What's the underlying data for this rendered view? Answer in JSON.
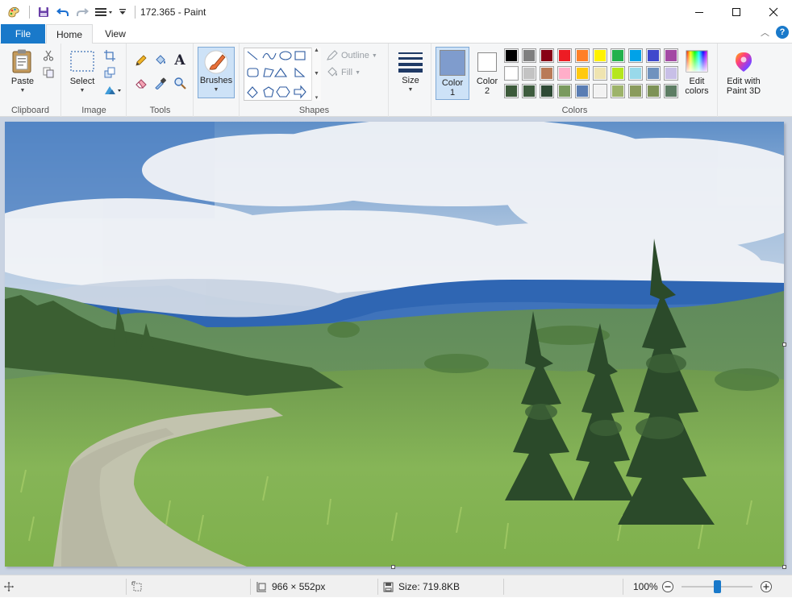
{
  "window": {
    "title": "172.365 - Paint"
  },
  "tabs": {
    "file": "File",
    "home": "Home",
    "view": "View"
  },
  "ribbon": {
    "clipboard": {
      "label": "Clipboard",
      "paste": "Paste"
    },
    "image": {
      "label": "Image",
      "select": "Select"
    },
    "tools": {
      "label": "Tools"
    },
    "brushes": "Brushes",
    "shapes": {
      "label": "Shapes",
      "outline": "Outline",
      "fill": "Fill"
    },
    "size": "Size",
    "color1": {
      "line1": "Color",
      "line2": "1"
    },
    "color2": {
      "line1": "Color",
      "line2": "2"
    },
    "colors": {
      "label": "Colors"
    },
    "edit_colors": {
      "line1": "Edit",
      "line2": "colors"
    },
    "paint3d": {
      "line1": "Edit with",
      "line2": "Paint 3D"
    }
  },
  "palette": {
    "color1": "#7f9ccd",
    "color2": "#ffffff",
    "row1": [
      "#000000",
      "#7f7f7f",
      "#880015",
      "#ed1c24",
      "#ff7f27",
      "#fff200",
      "#22b14c",
      "#00a2e8",
      "#3f48cc",
      "#a349a4"
    ],
    "row2": [
      "#ffffff",
      "#c3c3c3",
      "#b97a57",
      "#ffaec9",
      "#ffc90e",
      "#efe4b0",
      "#b5e61d",
      "#99d9ea",
      "#7092be",
      "#c8bfe7"
    ],
    "row3": [
      "#3c5a3a",
      "#3e5c3e",
      "#2f4a35",
      "#7a9a5e",
      "#5a7db3",
      "#f2f2f2",
      "#9db36a",
      "#8a9b5d",
      "#7d9256",
      "#5d7d64"
    ]
  },
  "status": {
    "dimensions": "966 × 552px",
    "size": "Size: 719.8KB",
    "zoom": "100%",
    "zoom_level": 0.5
  }
}
